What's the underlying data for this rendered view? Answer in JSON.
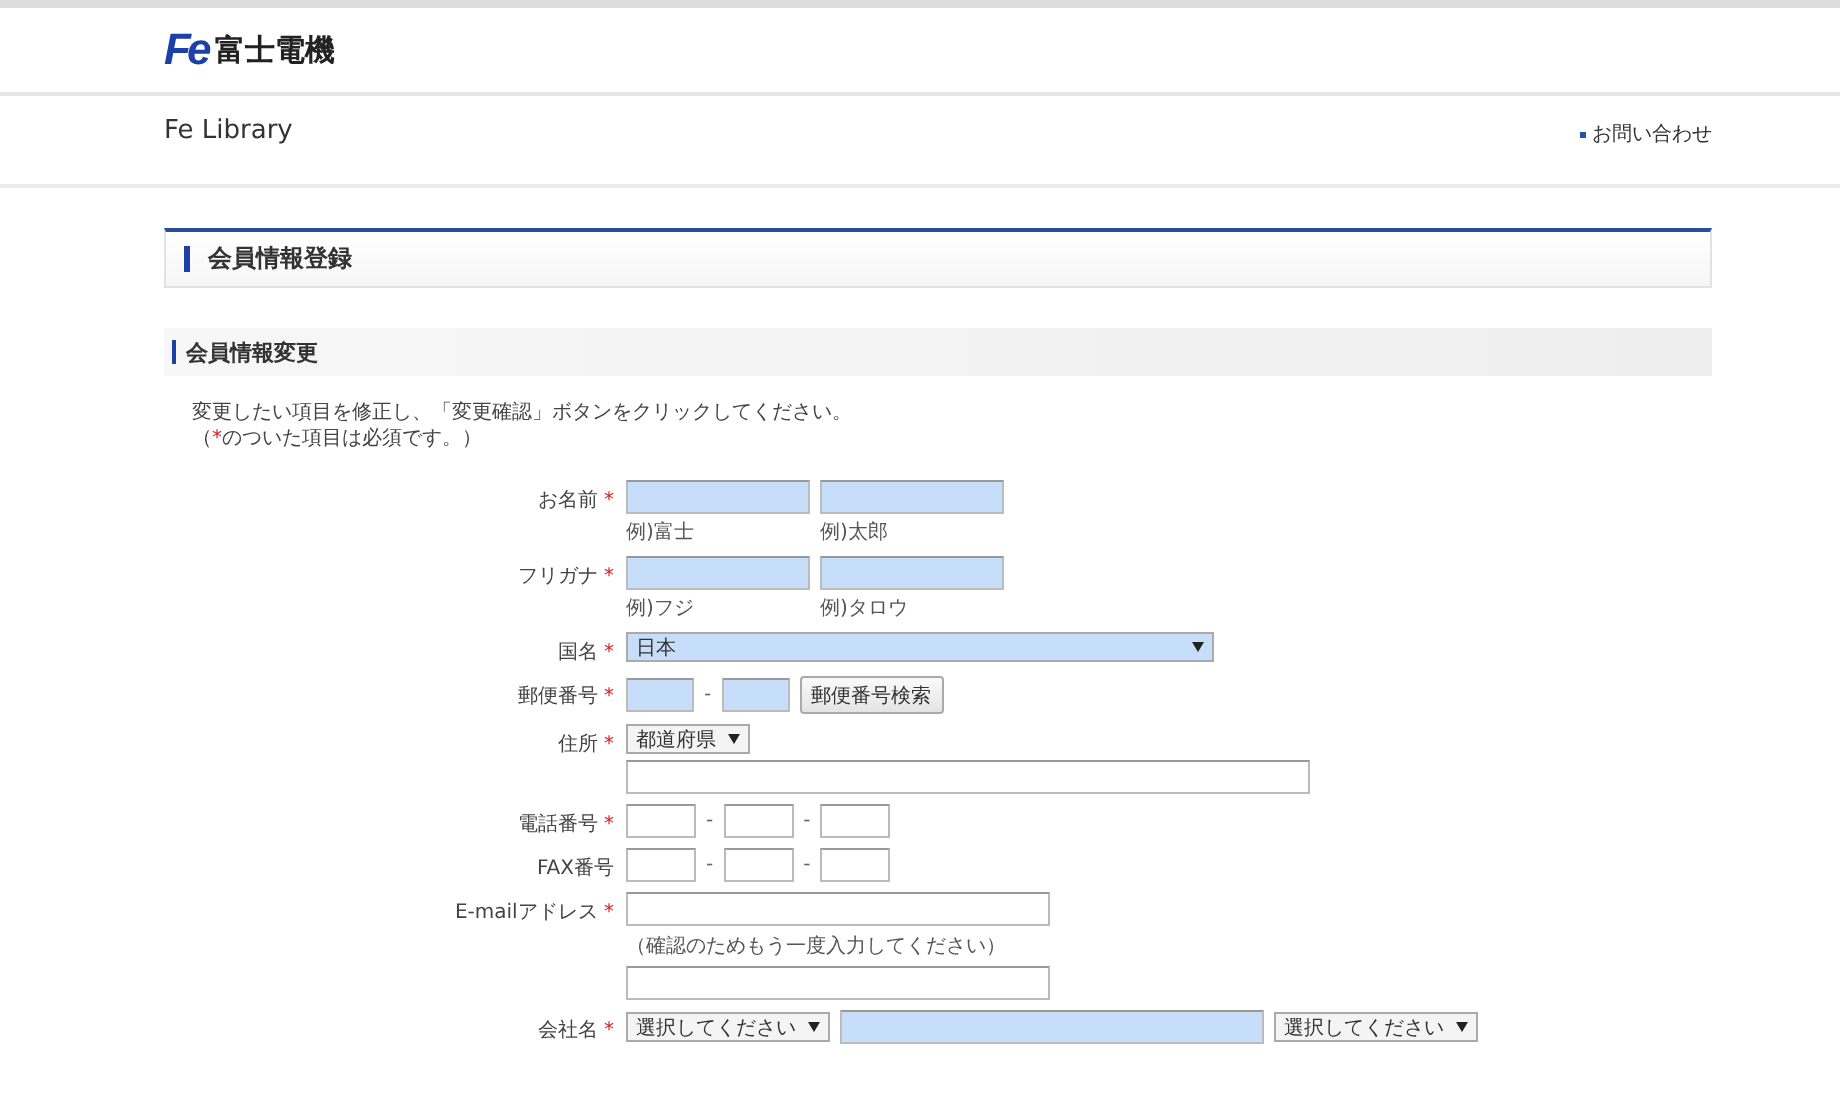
{
  "header": {
    "logo_mark": "Fe",
    "logo_text": "富士電機",
    "site_name": "Fe Library",
    "contact_link": "お問い合わせ"
  },
  "page_title": "会員情報登録",
  "section_title": "会員情報変更",
  "intro": "変更したい項目を修正し、「変更確認」ボタンをクリックしてください。",
  "intro_note": {
    "before": "（",
    "mark": "*",
    "after": "のついた項目は必須です。）"
  },
  "form": {
    "required_mark": "*",
    "rows": [
      {
        "label": "お名前",
        "required": true,
        "kind": "pair",
        "fields": [
          {
            "hint": "例)富士",
            "highlighted": true
          },
          {
            "hint": "例)太郎",
            "highlighted": true
          }
        ]
      },
      {
        "label": "フリガナ",
        "required": true,
        "kind": "pair",
        "fields": [
          {
            "hint": "例)フジ",
            "highlighted": true
          },
          {
            "hint": "例)タロウ",
            "highlighted": true
          }
        ]
      },
      {
        "label": "国名",
        "required": true,
        "kind": "select",
        "value": "日本",
        "highlighted": true
      },
      {
        "label": "郵便番号",
        "required": true,
        "kind": "postal",
        "separator": "-",
        "fields": [
          {
            "highlighted": true
          },
          {
            "highlighted": true
          }
        ],
        "button": "郵便番号検索"
      },
      {
        "label": "住所",
        "required": true,
        "kind": "address",
        "value": "都道府県"
      },
      {
        "label": "電話番号",
        "required": true,
        "kind": "phone",
        "separator": "-",
        "fields": [
          {
            "highlighted": false
          },
          {
            "highlighted": false
          },
          {
            "highlighted": false
          }
        ]
      },
      {
        "label": "FAX番号",
        "required": false,
        "kind": "phone",
        "separator": "-",
        "fields": [
          {
            "highlighted": false
          },
          {
            "highlighted": false
          },
          {
            "highlighted": false
          }
        ]
      },
      {
        "label": "E-mailアドレス",
        "required": true,
        "kind": "email",
        "note": "（確認のためもう一度入力してください）"
      },
      {
        "label": "会社名",
        "required": true,
        "kind": "company",
        "selects": [
          "選択してください",
          "選択してください"
        ]
      }
    ]
  }
}
